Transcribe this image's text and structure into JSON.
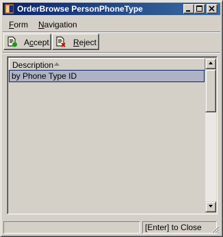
{
  "window": {
    "title": "OrderBrowse PersonPhoneType",
    "icon": "app-window-icon",
    "controls": [
      "minimize-icon",
      "maximize-icon",
      "close-icon"
    ]
  },
  "menu": {
    "items": [
      {
        "accel": "F",
        "rest": "orm"
      },
      {
        "accel": "N",
        "rest": "avigation"
      }
    ]
  },
  "toolbar": {
    "accept": {
      "prefix": "A",
      "accel": "c",
      "rest": "cept",
      "icon": "document-check-icon"
    },
    "reject": {
      "prefix": "",
      "accel": "R",
      "rest": "eject",
      "icon": "document-cross-icon"
    }
  },
  "list": {
    "columns": [
      "Description"
    ],
    "sort_icon": "sort-ascending-icon",
    "rows": [
      [
        "by Phone Type ID"
      ]
    ],
    "selected_row": 0,
    "selection_color": "#aeb2c4"
  },
  "status": {
    "left": "",
    "right": "[Enter] to Close"
  },
  "colors": {
    "face": "#d4d0c8",
    "title_start": "#0a246a",
    "title_end": "#3a6ea5"
  }
}
